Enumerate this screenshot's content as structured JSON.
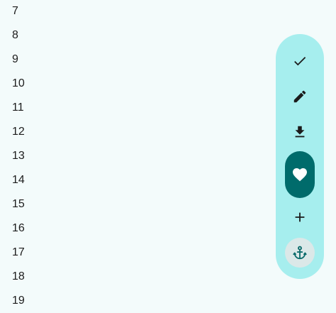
{
  "list": {
    "items": [
      "7",
      "8",
      "9",
      "10",
      "11",
      "12",
      "13",
      "14",
      "15",
      "16",
      "17",
      "18",
      "19"
    ]
  },
  "toolbar": {
    "buttons": [
      {
        "icon": "check-icon"
      },
      {
        "icon": "pencil-icon"
      },
      {
        "icon": "download-icon"
      },
      {
        "icon": "heart-icon",
        "selected": true
      },
      {
        "icon": "plus-icon"
      },
      {
        "icon": "anchor-icon"
      }
    ]
  },
  "colors": {
    "background": "#f3fbfb",
    "toolbar": "#a6eeee",
    "selected": "#006b6b",
    "anchor_bg": "#dbe8e8",
    "anchor_icon": "#0b6b6b",
    "text": "#1c1c1c"
  }
}
